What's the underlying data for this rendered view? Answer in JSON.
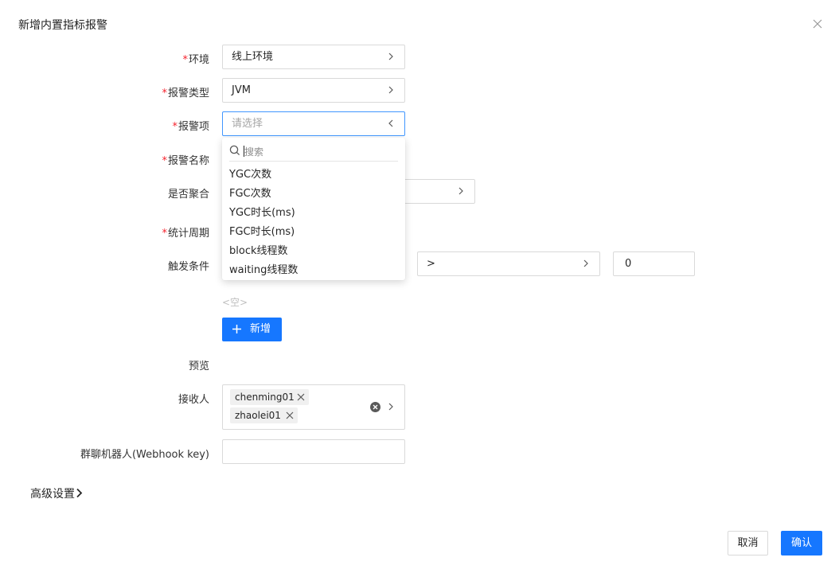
{
  "dialog": {
    "title": "新增内置指标报警",
    "close_icon": "close-icon"
  },
  "form": {
    "env": {
      "label": "环境",
      "required": "*",
      "value": "线上环境"
    },
    "alarm_type": {
      "label": "报警类型",
      "required": "*",
      "value": "JVM"
    },
    "alarm_item": {
      "label": "报警项",
      "required": "*",
      "placeholder": "请选择"
    },
    "alarm_name": {
      "label": "报警名称",
      "required": "*"
    },
    "aggregate": {
      "label": "是否聚合"
    },
    "period": {
      "label": "统计周期",
      "required": "*"
    },
    "trigger": {
      "label": "触发条件",
      "operator": ">",
      "threshold": "0"
    },
    "empty_text": "<空>",
    "add_button": "新增",
    "preview": {
      "label": "预览"
    },
    "receivers": {
      "label": "接收人",
      "tags": [
        "chenming01",
        "zhaolei01"
      ]
    },
    "webhook": {
      "label": "群聊机器人(Webhook key)",
      "value": ""
    }
  },
  "dropdown": {
    "search_placeholder": "搜索",
    "items": [
      "YGC次数",
      "FGC次数",
      "YGC时长(ms)",
      "FGC时长(ms)",
      "block线程数",
      "waiting线程数"
    ]
  },
  "advanced": {
    "label": "高级设置"
  },
  "footer": {
    "cancel": "取消",
    "confirm": "确认"
  },
  "colors": {
    "primary": "#1677ff",
    "required": "#f5222d",
    "border": "#d9d9d9"
  }
}
